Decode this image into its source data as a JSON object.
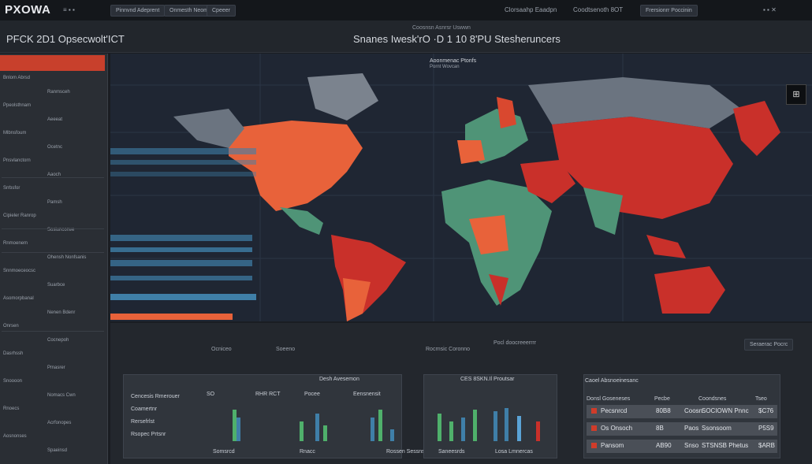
{
  "app": {
    "logo": "PXOWA",
    "top_items": [
      "Pinnvnd Adeprent",
      "Onmesth Neomer",
      "Cpeeer"
    ],
    "top_right": [
      "Clorsaahp Eaadpn",
      "Coodtsenoth 8OT",
      "Frersionrr Poccinin"
    ],
    "brand_title": "PFCK 2D1 Opsecwolt'ICT",
    "headline_small": "Coosnsn Asnrsr Uswwn",
    "headline": "Snanes Iwesk'rO ·D 1 10 8'PU Stesheruncers",
    "colors": {
      "accent": "#c8402c",
      "orange": "#e8623a",
      "red": "#c9302a",
      "green": "#4f9477",
      "blue": "#3f7fa8"
    }
  },
  "sidebar": {
    "items": [
      "Bnlom Abrsd",
      "Ranmsceh",
      "Ppeolsthnam",
      "Aeeeat",
      "Mlbnsfoum",
      "Ocetnc",
      "Pnsvlanctorn",
      "Aaoch",
      "Srrbsfor",
      "Pamsh",
      "Cipieler Ranrop",
      "Sosiuncorwe",
      "Rnmoenem",
      "Ohensh Nonfsanis",
      "Snnmoeceocsc",
      "Suarbce",
      "Asomorpbanal",
      "Nenen Bdenr",
      "Onrsen",
      "Cocnepoh",
      "Dasrhssh",
      "Pmasrer",
      "Snoooon",
      "Nomacs Cwn",
      "Rnoecs",
      "Acrfonopes",
      "Aosnonses",
      "Spaeinsd"
    ]
  },
  "map": {
    "label": "Aoonmenac Ptonfs",
    "sublabel": "Pornt Wovcan"
  },
  "lower": {
    "tabs": [
      "Ocniceo",
      "Soeeno",
      "Rocrnsic Coronno",
      "Pocl doocreeerrrr"
    ],
    "toggle_label": "Seraerac Pocrc",
    "panel1_title": "Desh Avesemon",
    "panel1_labels": [
      "Cencesis Rmerouer",
      "Coamertnr",
      "Rersefrlst",
      "Rsopec Prtsnr"
    ],
    "panel1_subheads": [
      "SO",
      "RHR RCT",
      "Pocee",
      "Eensnensit"
    ],
    "panel1_footer": [
      "Somsrcd",
      "Rnacc",
      "Rossen Sessns"
    ],
    "panel2_title": "CES 8SKN.Il Proutsar",
    "panel2_footer": [
      "Saneesrds",
      "Losa Lmnercas"
    ],
    "table": {
      "title": "Caoel Absnoeinesanc",
      "headers": [
        "Donsl Goseneses",
        "Pecbe",
        "Coondsnes",
        "Tseo"
      ],
      "rows": [
        [
          "Pecsnrcd",
          "80B8",
          "Coosn",
          "SOCIOWN Pnnc",
          "$C76"
        ],
        [
          "Os Onsoch",
          "8B",
          "Paos",
          "Ssonsoom",
          "P5S9"
        ],
        [
          "Pansom",
          "AB90",
          "Snso",
          "STSNSB Phetus",
          "$ARB"
        ]
      ]
    }
  }
}
